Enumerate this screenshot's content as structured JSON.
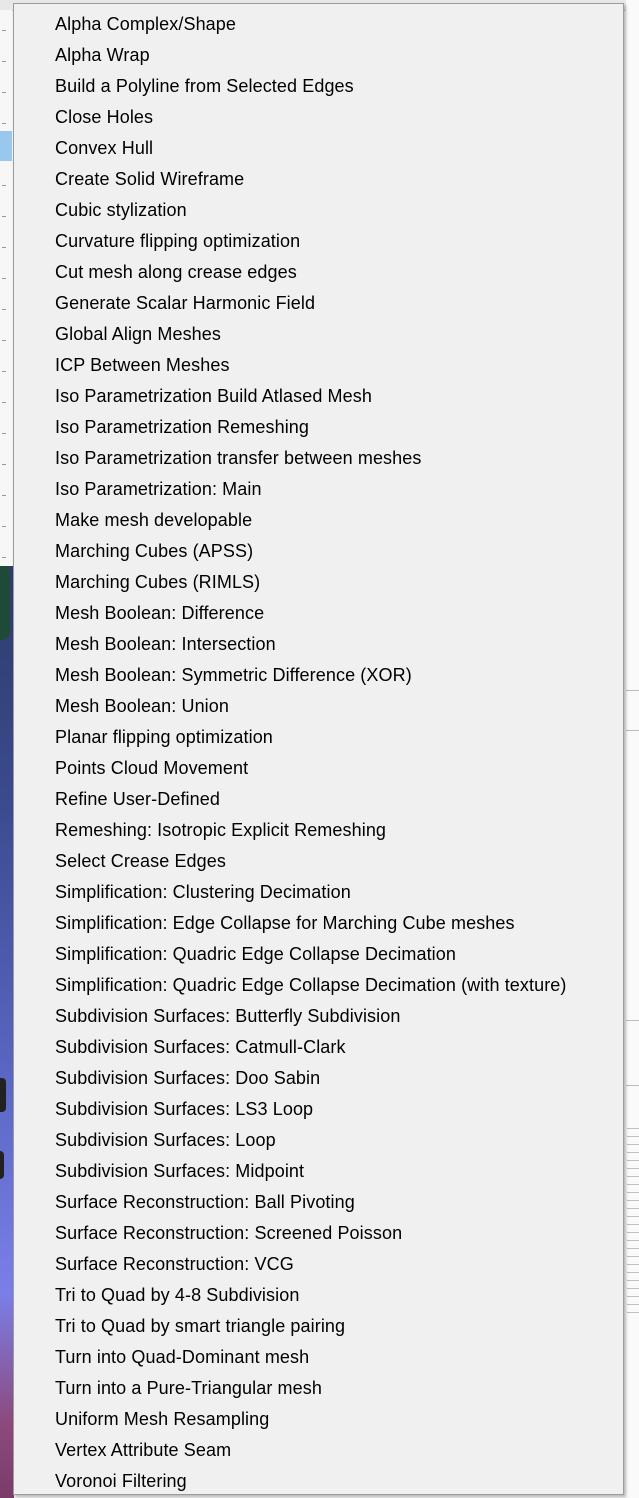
{
  "menu": {
    "items": [
      {
        "label": "Alpha Complex/Shape"
      },
      {
        "label": "Alpha Wrap"
      },
      {
        "label": "Build a Polyline from Selected Edges"
      },
      {
        "label": "Close Holes"
      },
      {
        "label": "Convex Hull"
      },
      {
        "label": "Create Solid Wireframe"
      },
      {
        "label": "Cubic stylization"
      },
      {
        "label": "Curvature flipping optimization"
      },
      {
        "label": "Cut mesh along crease edges"
      },
      {
        "label": "Generate Scalar Harmonic Field"
      },
      {
        "label": "Global Align Meshes"
      },
      {
        "label": "ICP Between Meshes"
      },
      {
        "label": "Iso Parametrization Build Atlased Mesh"
      },
      {
        "label": "Iso Parametrization Remeshing"
      },
      {
        "label": "Iso Parametrization transfer between meshes"
      },
      {
        "label": "Iso Parametrization: Main"
      },
      {
        "label": "Make mesh developable"
      },
      {
        "label": "Marching Cubes (APSS)"
      },
      {
        "label": "Marching Cubes (RIMLS)"
      },
      {
        "label": "Mesh Boolean: Difference"
      },
      {
        "label": "Mesh Boolean: Intersection"
      },
      {
        "label": "Mesh Boolean: Symmetric Difference (XOR)"
      },
      {
        "label": "Mesh Boolean: Union"
      },
      {
        "label": "Planar flipping optimization"
      },
      {
        "label": "Points Cloud Movement"
      },
      {
        "label": "Refine User-Defined"
      },
      {
        "label": "Remeshing: Isotropic Explicit Remeshing"
      },
      {
        "label": "Select Crease Edges"
      },
      {
        "label": "Simplification: Clustering Decimation"
      },
      {
        "label": "Simplification: Edge Collapse for Marching Cube meshes"
      },
      {
        "label": "Simplification: Quadric Edge Collapse Decimation"
      },
      {
        "label": "Simplification: Quadric Edge Collapse Decimation (with texture)"
      },
      {
        "label": "Subdivision Surfaces: Butterfly Subdivision"
      },
      {
        "label": "Subdivision Surfaces: Catmull-Clark"
      },
      {
        "label": "Subdivision Surfaces: Doo Sabin"
      },
      {
        "label": "Subdivision Surfaces: LS3 Loop"
      },
      {
        "label": "Subdivision Surfaces: Loop"
      },
      {
        "label": "Subdivision Surfaces: Midpoint"
      },
      {
        "label": "Surface Reconstruction: Ball Pivoting"
      },
      {
        "label": "Surface Reconstruction: Screened Poisson"
      },
      {
        "label": "Surface Reconstruction: VCG"
      },
      {
        "label": "Tri to Quad by 4-8 Subdivision"
      },
      {
        "label": "Tri to Quad by smart triangle pairing"
      },
      {
        "label": "Turn into Quad-Dominant mesh"
      },
      {
        "label": "Turn into a Pure-Triangular mesh"
      },
      {
        "label": "Uniform Mesh Resampling"
      },
      {
        "label": "Vertex Attribute Seam"
      },
      {
        "label": "Voronoi Filtering"
      }
    ]
  },
  "colors": {
    "menu_background": "#f0f0f0",
    "menu_border": "#9c9c9c",
    "text": "#000000",
    "selected_tab": "#98c8ee"
  }
}
